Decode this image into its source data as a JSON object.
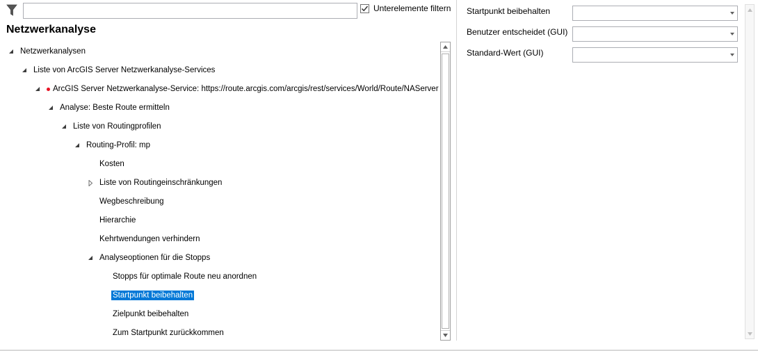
{
  "filter": {
    "value": "",
    "placeholder": "",
    "icon": "funnel-icon",
    "checkbox_checked": true,
    "checkbox_label": "Unterelemente filtern"
  },
  "page_title": "Netzwerkanalyse",
  "tree": [
    {
      "label": "Netzwerkanalysen",
      "level": 0,
      "toggle": "expanded",
      "status": false,
      "selected": false
    },
    {
      "label": "Liste von ArcGIS Server Netzwerkanalyse-Services",
      "level": 1,
      "toggle": "expanded",
      "status": false,
      "selected": false
    },
    {
      "label": "ArcGIS Server Netzwerkanalyse-Service: https://route.arcgis.com/arcgis/rest/services/World/Route/NAServer",
      "level": 2,
      "toggle": "expanded",
      "status": true,
      "selected": false
    },
    {
      "label": "Analyse: Beste Route ermitteln",
      "level": 3,
      "toggle": "expanded",
      "status": false,
      "selected": false
    },
    {
      "label": "Liste von Routingprofilen",
      "level": 4,
      "toggle": "expanded",
      "status": false,
      "selected": false
    },
    {
      "label": "Routing-Profil: mp",
      "level": 5,
      "toggle": "expanded",
      "status": false,
      "selected": false
    },
    {
      "label": "Kosten",
      "level": 6,
      "toggle": "none",
      "status": false,
      "selected": false
    },
    {
      "label": "Liste von Routingeinschränkungen",
      "level": 6,
      "toggle": "collapsed",
      "status": false,
      "selected": false
    },
    {
      "label": "Wegbeschreibung",
      "level": 6,
      "toggle": "none",
      "status": false,
      "selected": false
    },
    {
      "label": "Hierarchie",
      "level": 6,
      "toggle": "none",
      "status": false,
      "selected": false
    },
    {
      "label": "Kehrtwendungen verhindern",
      "level": 6,
      "toggle": "none",
      "status": false,
      "selected": false
    },
    {
      "label": "Analyseoptionen für die Stopps",
      "level": 6,
      "toggle": "expanded",
      "status": false,
      "selected": false
    },
    {
      "label": "Stopps für optimale Route neu anordnen",
      "level": 7,
      "toggle": "none",
      "status": false,
      "selected": false
    },
    {
      "label": "Startpunkt beibehalten",
      "level": 7,
      "toggle": "none",
      "status": false,
      "selected": true
    },
    {
      "label": "Zielpunkt beibehalten",
      "level": 7,
      "toggle": "none",
      "status": false,
      "selected": false
    },
    {
      "label": "Zum Startpunkt zurückkommen",
      "level": 7,
      "toggle": "none",
      "status": false,
      "selected": false
    }
  ],
  "properties": [
    {
      "label": "Startpunkt beibehalten",
      "value": ""
    },
    {
      "label": "Benutzer entscheidet (GUI)",
      "value": ""
    },
    {
      "label": "Standard-Wert (GUI)",
      "value": ""
    }
  ],
  "colors": {
    "selection": "#0078d7",
    "status_dot": "#e81123",
    "border": "#abadb3"
  }
}
